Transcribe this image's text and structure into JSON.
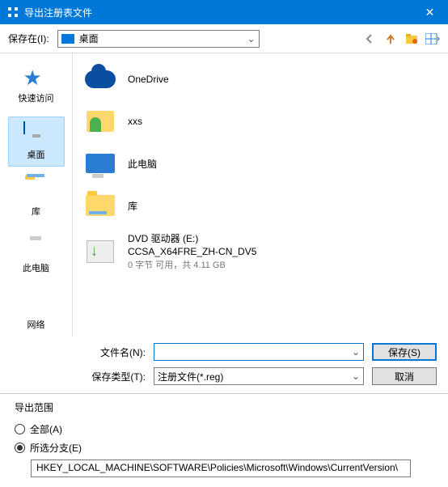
{
  "window": {
    "title": "导出注册表文件",
    "close": "✕"
  },
  "toolbar": {
    "save_in_label": "保存在(I):",
    "location": "桌面",
    "nav": {
      "back": "←",
      "up": "↑",
      "newfolder": "📁",
      "view": "▦"
    }
  },
  "sidebar": {
    "items": [
      {
        "label": "快速访问"
      },
      {
        "label": "桌面"
      },
      {
        "label": "库"
      },
      {
        "label": "此电脑"
      },
      {
        "label": "网络"
      }
    ]
  },
  "filelist": [
    {
      "name": "OneDrive",
      "icon": "cloud"
    },
    {
      "name": "xxs",
      "icon": "userfolder"
    },
    {
      "name": "此电脑",
      "icon": "pc"
    },
    {
      "name": "库",
      "icon": "folder-lib"
    },
    {
      "name": "DVD 驱动器 (E:)",
      "sub1": "CCSA_X64FRE_ZH-CN_DV5",
      "sub2": "0 字节 可用，共 4.11 GB",
      "icon": "dvd"
    }
  ],
  "fields": {
    "filename_label": "文件名(N):",
    "filename_value": "",
    "filetype_label": "保存类型(T):",
    "filetype_value": "注册文件(*.reg)",
    "save_button": "保存(S)",
    "cancel_button": "取消"
  },
  "export": {
    "group_label": "导出范围",
    "all_label": "全部(A)",
    "branch_label": "所选分支(E)",
    "branch_value": "HKEY_LOCAL_MACHINE\\SOFTWARE\\Policies\\Microsoft\\Windows\\CurrentVersion\\"
  }
}
